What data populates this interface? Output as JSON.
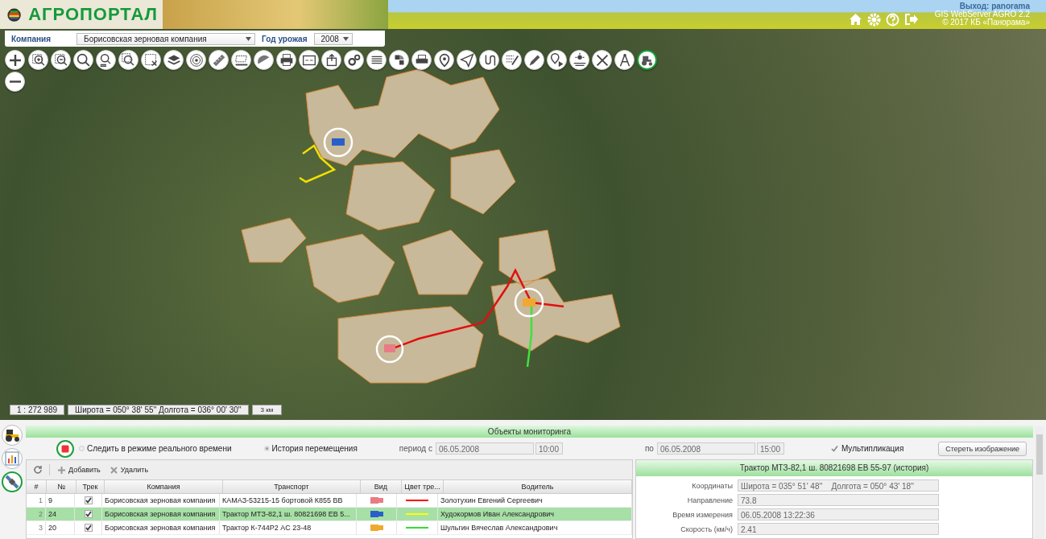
{
  "header": {
    "logo_text": "АГРОПОРТАЛ",
    "user": "Выход: panorama",
    "version": "GIS WebServer AGRO 2.2",
    "copyright": "© 2017 КБ «Панорама»"
  },
  "filters": {
    "company_label": "Компания",
    "company_value": "Борисовская зерновая компания",
    "year_label": "Год урожая",
    "year_value": "2008"
  },
  "map_status": {
    "scale": "1 : 272 989",
    "coords": "Широта = 050° 38' 55'' Долгота = 036° 00' 30''",
    "scale_bar": "3 км"
  },
  "side_tabs": [
    {
      "kind": "tractor",
      "selected": false
    },
    {
      "kind": "chart",
      "selected": false
    },
    {
      "kind": "satellite",
      "selected": true
    }
  ],
  "panel": {
    "title": "Объекты мониторинга",
    "modes": [
      {
        "label": "Следить в режиме реального времени",
        "selected": false
      },
      {
        "label": "История перемещения",
        "selected": true
      }
    ],
    "period_label": "период с",
    "from_date": "06.05.2008",
    "from_time": "10:00",
    "to_label": "по",
    "to_date": "06.05.2008",
    "to_time": "15:00",
    "multiplication": {
      "label": "Мультипликация",
      "checked": true
    },
    "clear_button": "Стереть изображение"
  },
  "table": {
    "toolbar": [
      "Добавить",
      "Удалить"
    ],
    "columns": [
      "#",
      "№",
      "Трек",
      "Компания",
      "Транспорт",
      "Вид",
      "Цвет тре...",
      "Водитель"
    ],
    "rows": [
      {
        "index": "1",
        "number": "9",
        "track": true,
        "company": "Борисовская зерновая компания",
        "transport": "КАМАЗ-53215-15 бортовой К855 ВВ",
        "vehicle_icon": {
          "color": "#e87c84"
        },
        "track_line": {
          "color": "#ff0000"
        },
        "driver": "Золотухин Евгений Сергеевич",
        "selected": false
      },
      {
        "index": "2",
        "number": "24",
        "track": true,
        "company": "Борисовская зерновая компания",
        "transport": "Трактор МТЗ-82,1 ш. 80821698 ЕВ 5...",
        "vehicle_icon": {
          "color": "#2a5fc8"
        },
        "track_line": {
          "color": "#ffff00"
        },
        "driver": "Худокормов Иван Александрович",
        "selected": true
      },
      {
        "index": "3",
        "number": "20",
        "track": true,
        "company": "Борисовская зерновая компания",
        "transport": "Трактор К-744Р2 АС 23-48",
        "vehicle_icon": {
          "color": "#f0a830"
        },
        "track_line": {
          "color": "#33dd33"
        },
        "driver": "Шульгин Вячеслав Александрович",
        "selected": false
      }
    ]
  },
  "details": {
    "title": "Трактор МТЗ-82,1 ш. 80821698 ЕВ 55-97 (история)",
    "fields": [
      {
        "label": "Координаты",
        "value": "Широта = 035° 51' 48''    Долгота = 050° 43' 18''"
      },
      {
        "label": "Направление",
        "value": "73.8"
      },
      {
        "label": "Время измерения",
        "value": "06.05.2008 13:22:36"
      },
      {
        "label": "Скорость (км/ч)",
        "value": "2.41"
      }
    ]
  }
}
